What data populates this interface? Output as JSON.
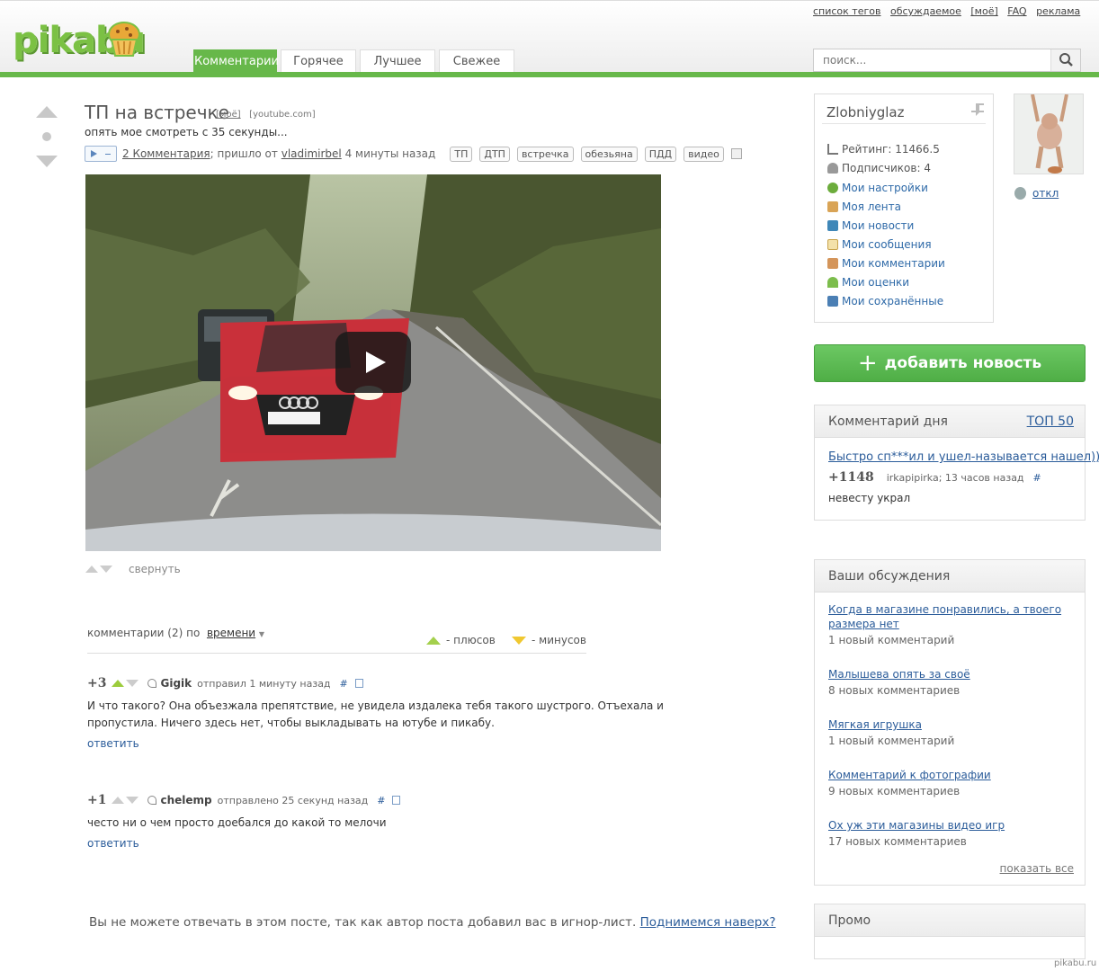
{
  "header": {
    "logo_text": "pikabu",
    "top_links": [
      "список тегов",
      "обсуждаемое",
      "[моё]",
      "FAQ",
      "реклама"
    ],
    "tabs": [
      "Комментарии",
      "Горячее",
      "Лучшее",
      "Свежее"
    ],
    "active_tab": "Комментарии",
    "search_placeholder": "поиск..."
  },
  "post": {
    "title": "ТП на встречке",
    "mine_tag": "[моё]",
    "source": "[youtube.com]",
    "description": "опять мое смотреть с 35 секунды...",
    "comments_link": "2 Комментария",
    "came_from": "; пришло от",
    "author": "vladimirbel",
    "time": "4 минуты назад",
    "tags": [
      "ТП",
      "ДТП",
      "встречка",
      "обезьяна",
      "ПДД",
      "видео"
    ],
    "collapse_label": "свернуть"
  },
  "comments_section": {
    "header_prefix": "комментарии (2) по",
    "sort_by": "времени",
    "legend_plus": "-  плюсов",
    "legend_minus": "-  минусов",
    "items": [
      {
        "score": "+3",
        "author": "Gigik",
        "action": "отправил 1 минуту назад",
        "hash": "#",
        "text": "И что такого? Она объезжала препятствие, не увидела издалека тебя такого шустрого. Отъехала и пропустила. Ничего здесь нет, чтобы выкладывать на ютубе и пикабу.",
        "reply": "ответить"
      },
      {
        "score": "+1",
        "author": "chelemp",
        "action": "отправлено 25 секунд назад",
        "hash": "#",
        "text": "често ни о чем просто доебался до какой то мелочи",
        "reply": "ответить"
      }
    ],
    "bottom_note": "Вы не можете отвечать в этом посте, так как автор поста добавил вас в игнор-лист.",
    "back_to_top": "Поднимемся наверх?"
  },
  "user_panel": {
    "username": "Zlobniyglaz",
    "rating": "Рейтинг: 11466.5",
    "subscribers": "Подписчиков: 4",
    "links": [
      "Мои настройки",
      "Моя лента",
      "Мои новости",
      "Мои сообщения",
      "Мои комментарии",
      "Мои оценки",
      "Мои сохранённые"
    ],
    "logout": "откл"
  },
  "add_news_label": "добавить новость",
  "comment_of_day": {
    "title": "Комментарий дня",
    "top_link": "ТОП 50",
    "post_link": "Быстро сп***ил и ушел-называется нашел)))",
    "score": "+1148",
    "author_meta": "irkapipirka; 13 часов назад",
    "hash": "#",
    "text": "невесту украл"
  },
  "discussions": {
    "title": "Ваши обсуждения",
    "items": [
      {
        "link": "Когда в магазине понравились, а твоего размера нет",
        "count": "1 новый комментарий"
      },
      {
        "link": "Малышева опять за своё",
        "count": "8 новых комментариев"
      },
      {
        "link": "Мягкая игрушка",
        "count": "1 новый комментарий"
      },
      {
        "link": "Комментарий к фотографии",
        "count": "9 новых комментариев"
      },
      {
        "link": "Ох уж эти магазины видео игр",
        "count": "17 новых комментариев"
      }
    ],
    "show_all": "показать все"
  },
  "promo_title": "Промо",
  "watermark": "pikabu.ru",
  "colors": {
    "brand_green": "#67b84a",
    "link_blue": "#2b5c9a",
    "plus_green": "#a4d04d",
    "minus_yellow": "#f0c830"
  }
}
